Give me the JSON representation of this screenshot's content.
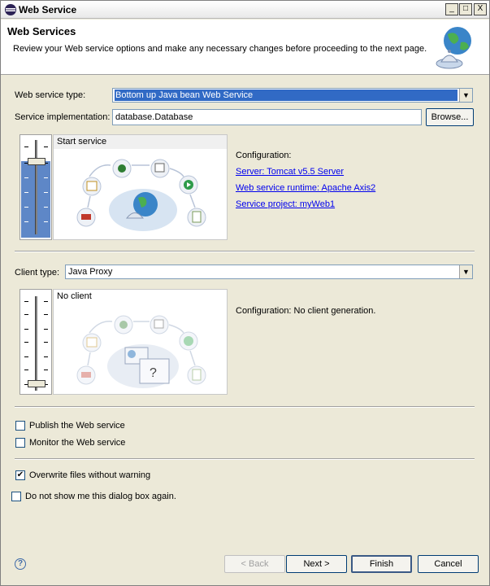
{
  "window": {
    "title": "Web Service",
    "minimize": "_",
    "maximize": "□",
    "close": "X"
  },
  "banner": {
    "title": "Web Services",
    "description": "Review your Web service options and make any necessary changes before proceeding to the next page."
  },
  "service": {
    "type_label": "Web service type:",
    "type_value": "Bottom up Java bean Web Service",
    "impl_label": "Service implementation:",
    "impl_value": "database.Database",
    "browse_label": "Browse...",
    "slider_level": "Start service",
    "config_title": "Configuration:",
    "links": [
      "Server: Tomcat v5.5 Server",
      "Web service runtime: Apache Axis2",
      "Service project: myWeb1"
    ]
  },
  "client": {
    "type_label": "Client type:",
    "type_value": "Java Proxy",
    "slider_level": "No client",
    "config_text": "Configuration: No client generation."
  },
  "options": {
    "publish": {
      "label": "Publish the Web service",
      "checked": false
    },
    "monitor": {
      "label": "Monitor the Web service",
      "checked": false
    },
    "overwrite": {
      "label": "Overwrite files without warning",
      "checked": true
    },
    "dont_show": {
      "label": "Do not show me this dialog box again.",
      "checked": false
    }
  },
  "buttons": {
    "help": "?",
    "back": "< Back",
    "next": "Next >",
    "finish": "Finish",
    "cancel": "Cancel"
  },
  "icons": {
    "dropdown_arrow": "chevron-down-icon",
    "check_mark": "✔"
  }
}
